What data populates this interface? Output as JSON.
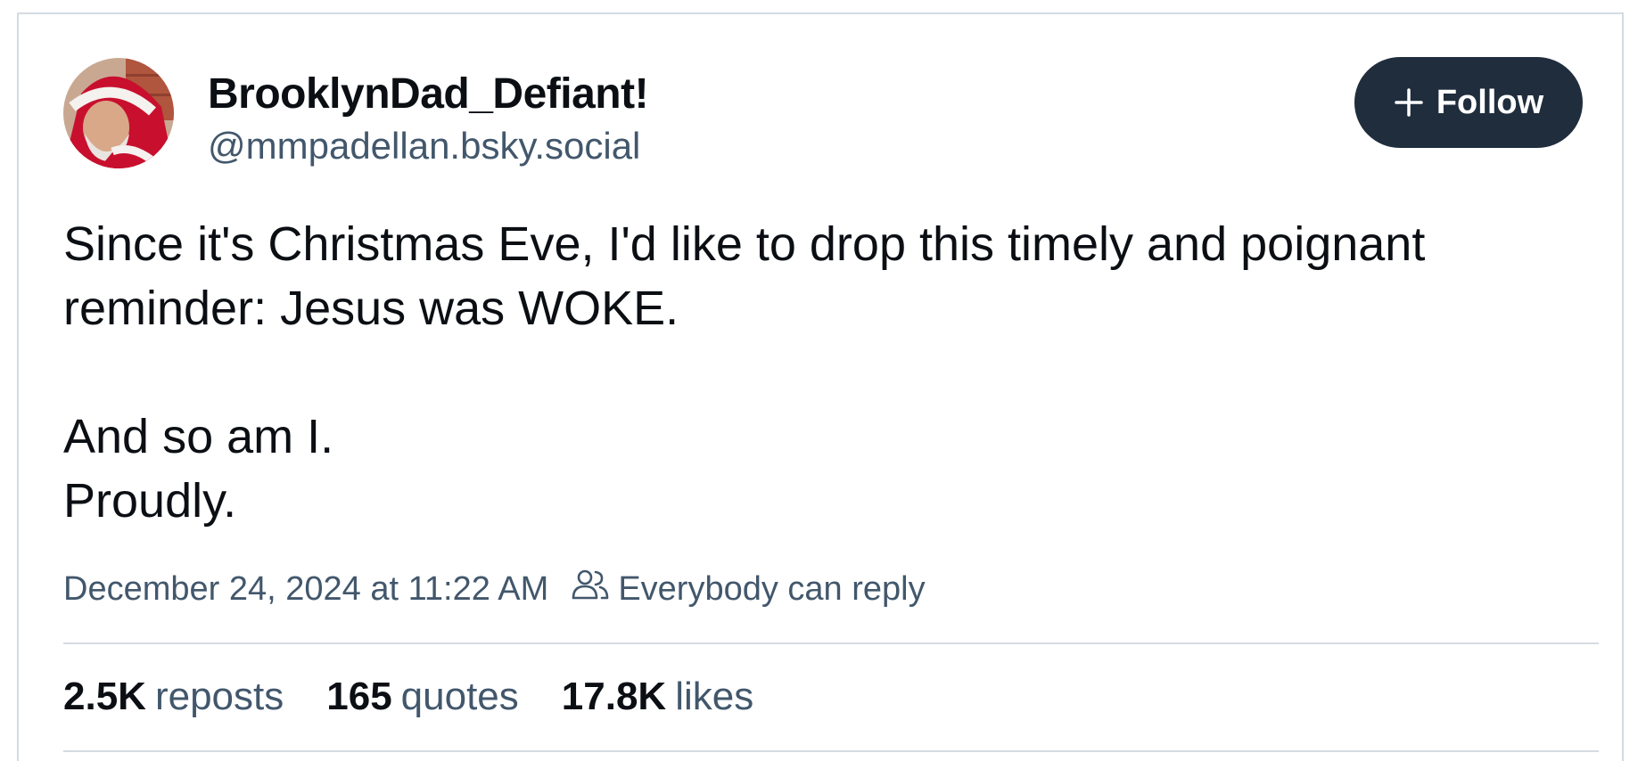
{
  "post": {
    "author": {
      "display_name": "BrooklynDad_Defiant!",
      "handle": "@mmpadellan.bsky.social"
    },
    "follow_label": "Follow",
    "text": {
      "line1": "Since it's Christmas Eve, I'd like to drop this timely and poignant",
      "line2": "reminder: Jesus was WOKE.",
      "line3": "And so am I.",
      "line4": "Proudly."
    },
    "timestamp": "December 24, 2024 at 11:22 AM",
    "reply_setting": "Everybody can reply",
    "stats": {
      "reposts": {
        "value": "2.5K",
        "label": "reposts"
      },
      "quotes": {
        "value": "165",
        "label": "quotes"
      },
      "likes": {
        "value": "17.8K",
        "label": "likes"
      }
    }
  },
  "icons": {
    "follow": "plus-icon",
    "reply_setting": "people-icon"
  },
  "colors": {
    "follow_button_bg": "#1f2d3d",
    "muted_text": "#42576c",
    "divider": "#d4dbe2"
  }
}
